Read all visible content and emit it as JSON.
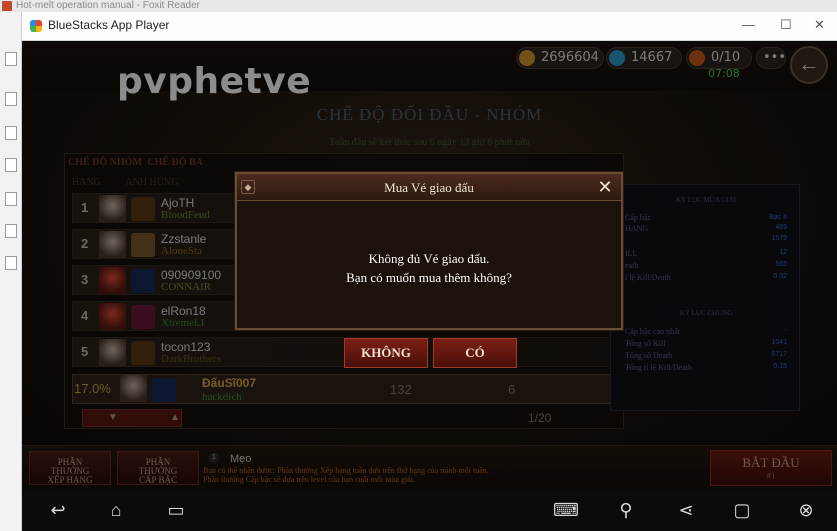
{
  "foxit": {
    "title": "Hot-melt operation manual - Foxit Reader"
  },
  "bluestacks": {
    "title": "BlueStacks App Player",
    "minimize": "—",
    "maximize": "☐",
    "close": "✕"
  },
  "resources": {
    "gold": "2696604",
    "gems": "14667",
    "tickets": "0/10",
    "timer": "07:08",
    "more": "•••"
  },
  "streamer_name": "pvphetve",
  "mode_title": "CHẾ ĐỘ ĐỐI ĐẦU - NHÓM",
  "season_note": "Tuần đấu sẽ kết thúc sau 6 ngày 13 giờ 6 phút nữa",
  "tabs": {
    "tab1": "CHẾ ĐỘ NHÓM",
    "tab2": "CHẾ ĐỘ BA"
  },
  "columns": {
    "rank": "HẠNG",
    "hero": "ANH HÙNG"
  },
  "leaderboard": [
    {
      "rank": "1",
      "name": "AjoTH",
      "guild": "BloodFeud"
    },
    {
      "rank": "2",
      "name": "Zzstanle",
      "guild": "AloneSta"
    },
    {
      "rank": "3",
      "name": "090909100",
      "guild": "CONNAIR"
    },
    {
      "rank": "4",
      "name": "elRon18",
      "guild": "XtremeLI"
    },
    {
      "rank": "5",
      "name": "tocon123",
      "guild": "DarkBrothers"
    }
  ],
  "self_row": {
    "percent": "17.0%",
    "name": "ĐấuSĩ007",
    "guild": "hackdich",
    "score": "132",
    "kills": "6"
  },
  "pager": {
    "page": "1/20",
    "down": "▼",
    "up": "▲"
  },
  "season_stats": {
    "title": "KỶ LỤC MÙA GIẢI",
    "rows": [
      {
        "label": "Cấp bậc",
        "value": "Bạc II"
      },
      {
        "label": "HẠNG",
        "value": "469"
      },
      {
        "label": "",
        "value": "1579"
      },
      {
        "label": "ILL",
        "value": "12"
      },
      {
        "label": "eath",
        "value": "565"
      },
      {
        "label": "ỉ lệ Kill/Death",
        "value": "0.02"
      }
    ]
  },
  "all_stats": {
    "title": "KỶ LỤC CHUNG",
    "rows": [
      {
        "label": "Cấp bậc cao nhất",
        "value": "-"
      },
      {
        "label": "Tổng số Kill",
        "value": "1041"
      },
      {
        "label": "Tổng số Death",
        "value": "6717"
      },
      {
        "label": "Tổng tỉ lệ Kill/Death",
        "value": "0.15"
      }
    ]
  },
  "bottom": {
    "reward_rank": [
      "PHẦN",
      "THƯỞNG",
      "XẾP HẠNG"
    ],
    "reward_level": [
      "PHẦN",
      "THƯỞNG",
      "CẤP BẬC"
    ],
    "tip_num": "1",
    "tip_title": "Mẹo",
    "tip_text1": "Bạn có thể nhận được: Phần thưởng Xếp hạng tuần dựa trên thứ hạng của mình mỗi tuần.",
    "tip_text2": "Phần thưởng Cấp bậc sẽ dựa trên level của bạn cuối mỗi mùa giải.",
    "start_label": "BẮT ĐẦU",
    "start_sub": "#1"
  },
  "dialog": {
    "title": "Mua Vé giao đấu",
    "message_line1": "Không đủ Vé giao đấu.",
    "message_line2": "Bạn có muốn mua thêm không?",
    "no_label": "KHÔNG",
    "yes_label": "CÓ",
    "close": "✕"
  },
  "colors": {
    "accent_red": "#7b1f15",
    "gold_text": "#d9a84a",
    "stat_blue": "#3d67c8"
  }
}
